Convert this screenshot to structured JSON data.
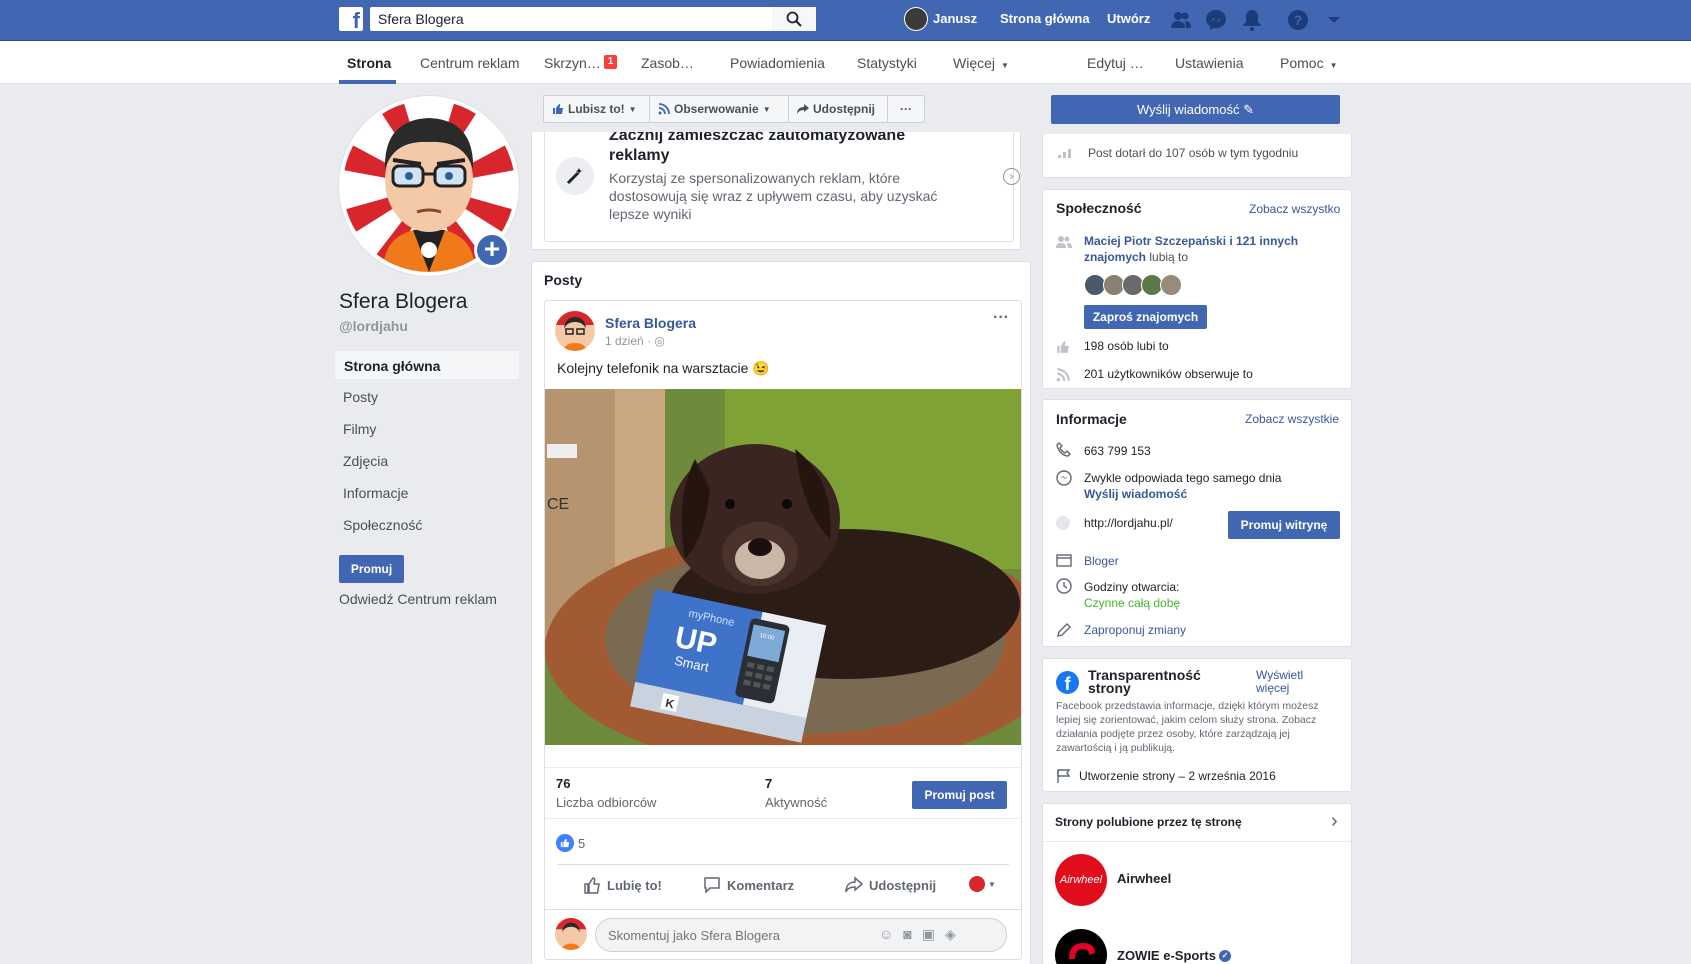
{
  "topbar": {
    "logo": "f",
    "search_value": "Sfera Blogera",
    "user_name": "Janusz",
    "home_label": "Strona główna",
    "create_label": "Utwórz"
  },
  "tabs": [
    {
      "label": "Strona"
    },
    {
      "label": "Centrum reklam"
    },
    {
      "label": "Skrzyn…",
      "badge": "1"
    },
    {
      "label": "Zasob…"
    },
    {
      "label": "Powiadomienia"
    },
    {
      "label": "Statystyki"
    },
    {
      "label": "Więcej"
    },
    {
      "label": "Edytuj …"
    },
    {
      "label": "Ustawienia"
    },
    {
      "label": "Pomoc"
    }
  ],
  "left": {
    "page_name": "Sfera Blogera",
    "handle": "@lordjahu",
    "nav": [
      "Strona główna",
      "Posty",
      "Filmy",
      "Zdjęcia",
      "Informacje",
      "Społeczność"
    ],
    "promote_label": "Promuj",
    "ads_center_label": "Odwiedź Centrum reklam"
  },
  "actions": {
    "like": "Lubisz to!",
    "follow": "Obserwowanie",
    "share": "Udostępnij",
    "more": "···",
    "send_message": "Wyślij wiadomość"
  },
  "ad_card": {
    "title": "Zacznij zamieszczać zautomatyzowane reklamy",
    "body": "Korzystaj ze spersonalizowanych reklam, które dostosowują się wraz z upływem czasu, aby uzyskać lepsze wyniki"
  },
  "posts": {
    "heading": "Posty",
    "author": "Sfera Blogera",
    "time": "1 dzień",
    "text": "Kolejny telefonik na warsztacie 😉",
    "reach_value": "76",
    "reach_label": "Liczba odbiorców",
    "engagement_value": "7",
    "engagement_label": "Aktywność",
    "promote_post": "Promuj post",
    "likes_count": "5",
    "like_btn": "Lubię to!",
    "comment_btn": "Komentarz",
    "share_btn": "Udostępnij",
    "comment_placeholder": "Skomentuj jako Sfera Blogera",
    "photo": {
      "box_brand": "myPhone",
      "box_model": "UP",
      "box_sub": "Smart",
      "phone_clock": "10:00",
      "box_logo": "K",
      "left_box_label": "CE"
    }
  },
  "right": {
    "reach_text": "Post dotarł do 107 osób w tym tygodniu",
    "community": {
      "title": "Społeczność",
      "see_all": "Zobacz wszystko",
      "friends_link": "Maciej Piotr Szczepański i 121 innych znajomych",
      "friends_suffix": "lubią to",
      "invite": "Zaproś znajomych",
      "likes": "198 osób lubi to",
      "followers": "201 użytkowników obserwuje to"
    },
    "info": {
      "title": "Informacje",
      "see_all": "Zobacz wszystkie",
      "phone": "663 799 153",
      "response": "Zwykle odpowiada tego samego dnia",
      "send_message": "Wyślij wiadomość",
      "website": "http://lordjahu.pl/",
      "promote_site": "Promuj witrynę",
      "category": "Bloger",
      "hours_label": "Godziny otwarcia:",
      "hours_value": "Czynne całą dobę",
      "suggest": "Zaproponuj zmiany"
    },
    "transparency": {
      "title": "Transparentność strony",
      "see_more": "Wyświetl więcej",
      "body": "Facebook przedstawia informacje, dzięki którym możesz lepiej się zorientować, jakim celom służy strona. Zobacz działania podjęte przez osoby, które zarządzają jej zawartością i ją publikują.",
      "created": "Utworzenie strony – 2 września 2016"
    },
    "liked_pages": {
      "title": "Strony polubione przez tę stronę",
      "pages": [
        {
          "name": "Airwheel",
          "logo": "Airwheel"
        },
        {
          "name": "ZOWIE e-Sports",
          "verified": "✓"
        }
      ]
    },
    "colors": {
      "brand": "#4267b2",
      "link": "#385898",
      "green": "#42b72a"
    }
  }
}
